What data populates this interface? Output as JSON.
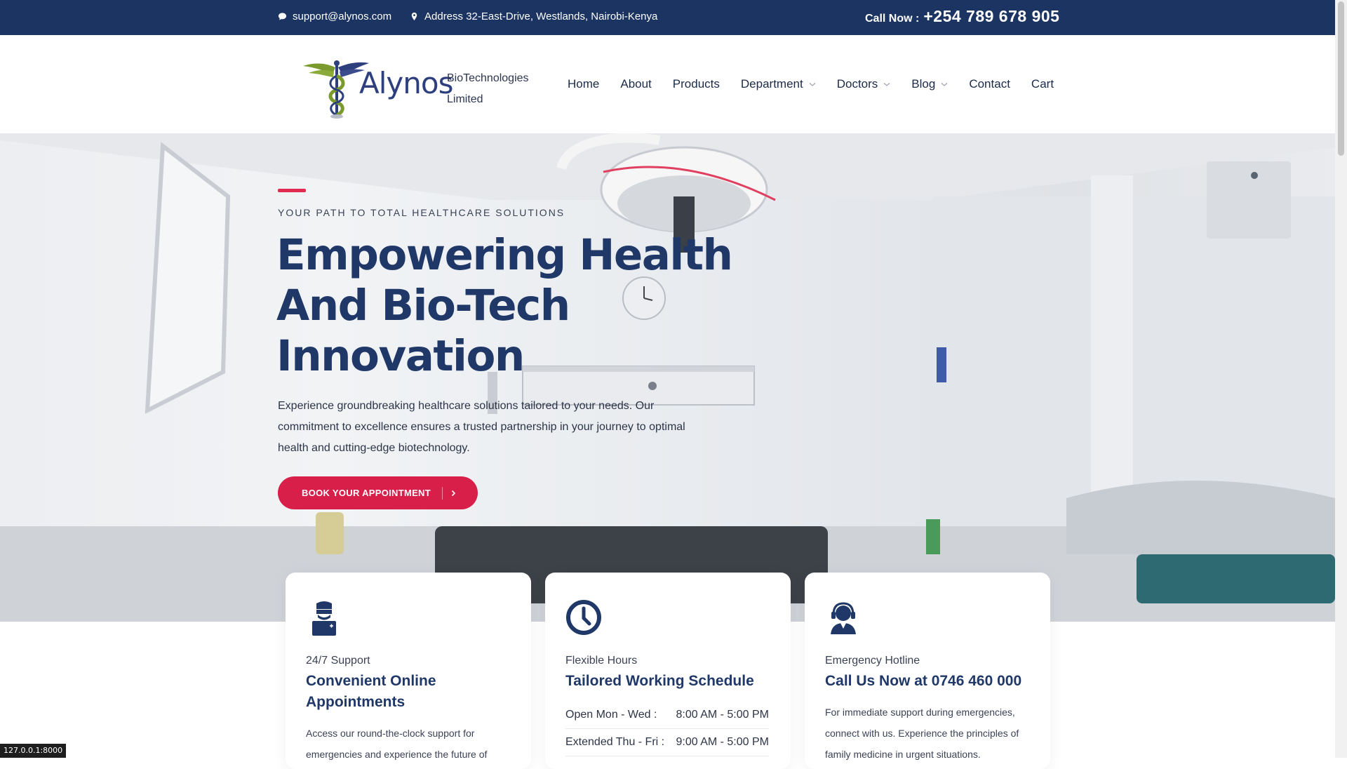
{
  "topbar": {
    "email": "support@alynos.com",
    "address": "Address 32-East-Drive, Westlands, Nairobi-Kenya",
    "call_label": "Call Now :",
    "call_number": "+254 789 678 905"
  },
  "brand": {
    "name": "Alynos",
    "tagline_line1": "BioTechnologies",
    "tagline_line2": "Limited"
  },
  "nav": {
    "home": "Home",
    "about": "About",
    "products": "Products",
    "department": "Department",
    "doctors": "Doctors",
    "blog": "Blog",
    "contact": "Contact",
    "cart": "Cart"
  },
  "hero": {
    "eyebrow": "YOUR PATH TO TOTAL HEALTHCARE SOLUTIONS",
    "headline_line1": "Empowering Health",
    "headline_line2": "And Bio-Tech",
    "headline_line3": "Innovation",
    "description": "Experience groundbreaking healthcare solutions tailored to your needs. Our commitment to excellence ensures a trusted partnership in your journey to optimal health and cutting-edge biotechnology.",
    "cta_label": "BOOK YOUR APPOINTMENT"
  },
  "cards": {
    "support": {
      "sub": "24/7 Support",
      "title": "Convenient Online Appointments",
      "body": "Access our round-the-clock support for emergencies and experience the future of"
    },
    "hours": {
      "sub": "Flexible Hours",
      "title": "Tailored Working Schedule",
      "rows": [
        {
          "label": "Open Mon - Wed :",
          "value": "8:00 AM - 5:00 PM"
        },
        {
          "label": "Extended Thu - Fri :",
          "value": "9:00 AM - 5:00 PM"
        }
      ]
    },
    "emergency": {
      "sub": "Emergency Hotline",
      "title": "Call Us Now at 0746 460 000",
      "body": "For immediate support during emergencies, connect with us. Experience the principles of family medicine in urgent situations."
    }
  },
  "status_url": "127.0.0.1:8000",
  "colors": {
    "navy": "#1b3461",
    "accent": "#d81f49",
    "heading": "#1f3868"
  }
}
